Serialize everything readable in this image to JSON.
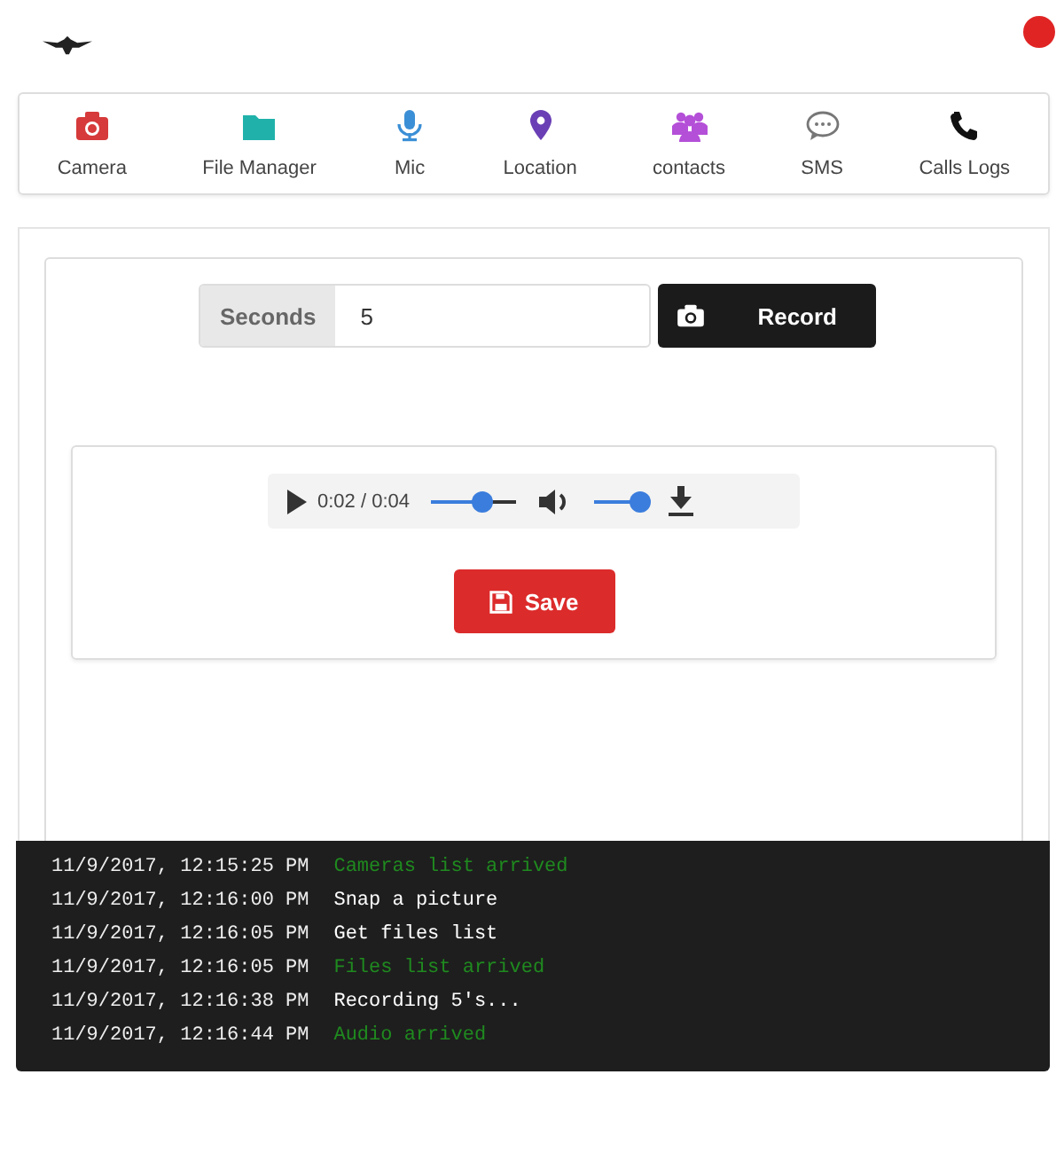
{
  "status_dot": {
    "color": "#e02424"
  },
  "nav": [
    {
      "label": "Camera",
      "color": "#d63a3a"
    },
    {
      "label": "File Manager",
      "color": "#20b2aa"
    },
    {
      "label": "Mic",
      "color": "#3b8fd6"
    },
    {
      "label": "Location",
      "color": "#6a3fb5"
    },
    {
      "label": "contacts",
      "color": "#b44fd8"
    },
    {
      "label": "SMS",
      "color": "#777777"
    },
    {
      "label": "Calls Logs",
      "color": "#111111"
    }
  ],
  "record": {
    "addon": "Seconds",
    "value": "5",
    "button": "Record"
  },
  "player": {
    "time": "0:02 / 0:04",
    "progress": {
      "level": 0.6
    },
    "volume": {
      "level": 0.85
    }
  },
  "save_button": "Save",
  "log": [
    {
      "time": "11/9/2017, 12:15:25 PM",
      "message": "Cameras list arrived",
      "kind": "success"
    },
    {
      "time": "11/9/2017, 12:16:00 PM",
      "message": "Snap a picture",
      "kind": "info"
    },
    {
      "time": "11/9/2017, 12:16:05 PM",
      "message": "Get files list",
      "kind": "info"
    },
    {
      "time": "11/9/2017, 12:16:05 PM",
      "message": "Files list arrived",
      "kind": "success"
    },
    {
      "time": "11/9/2017, 12:16:38 PM",
      "message": "Recording 5's...",
      "kind": "info"
    },
    {
      "time": "11/9/2017, 12:16:44 PM",
      "message": "Audio arrived",
      "kind": "success"
    }
  ]
}
